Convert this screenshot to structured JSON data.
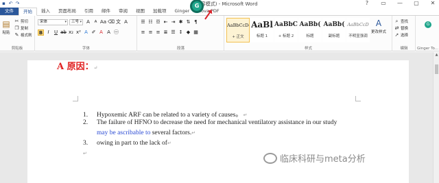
{
  "window": {
    "title": "(兼容模式) - Microsoft Word",
    "controls": [
      "?",
      "▭",
      "—",
      "▢",
      "✕"
    ]
  },
  "quick_access": [
    "save-icon",
    "undo-icon",
    "redo-icon"
  ],
  "tabs": [
    {
      "label": "文件"
    },
    {
      "label": "开始"
    },
    {
      "label": "插入"
    },
    {
      "label": "页面布局"
    },
    {
      "label": "引用"
    },
    {
      "label": "邮件"
    },
    {
      "label": "审阅"
    },
    {
      "label": "视图"
    },
    {
      "label": "加载项"
    },
    {
      "label": "Ginger"
    },
    {
      "label": "Nova PDF"
    }
  ],
  "ribbon": {
    "clipboard": {
      "paste": "粘贴",
      "cut": "剪切",
      "copy": "复制",
      "format_painter": "格式刷",
      "label": "剪贴板"
    },
    "font": {
      "name": "宋体",
      "size": "三号",
      "label": "字体"
    },
    "paragraph": {
      "label": "段落"
    },
    "styles": {
      "items": [
        {
          "sample": "AaBbCcDd",
          "name": "+ 正文"
        },
        {
          "sample": "AaBl",
          "name": "标题 1"
        },
        {
          "sample": "AaBbC",
          "name": "+ 标题 2"
        },
        {
          "sample": "AaBb(",
          "name": "标题"
        },
        {
          "sample": "AaBb(",
          "name": "副标题"
        },
        {
          "sample": "AaBbCcD",
          "name": "不明显强调"
        }
      ],
      "change": "更改样式",
      "label": "样式"
    },
    "editing": {
      "find": "查找",
      "replace": "替换",
      "select": "选择",
      "label": "编辑"
    },
    "ginger": {
      "label": "Ginger To..."
    }
  },
  "ginger_badge": "G",
  "document": {
    "heading": "A 原因：",
    "items": [
      {
        "num": "1.",
        "text": "Hypoxemic ARF can be related to a variety of causes。"
      },
      {
        "num": "2.",
        "text": "The failure of HFNO to decrease the need for mechanical ventilatory assistance in our study"
      },
      {
        "cont_blue": "may be ascribable to",
        "cont_rest": " several factors."
      },
      {
        "num": "3.",
        "text": "owing in part to the lack of"
      }
    ]
  },
  "watermark": "临床科研与meta分析"
}
